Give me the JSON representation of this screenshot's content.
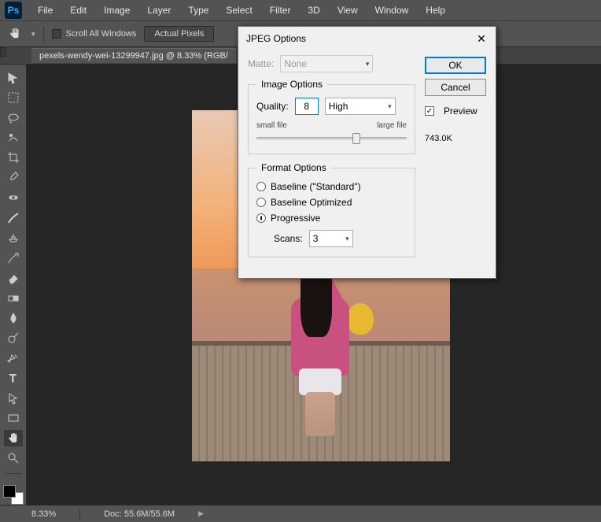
{
  "menubar": [
    "File",
    "Edit",
    "Image",
    "Layer",
    "Type",
    "Select",
    "Filter",
    "3D",
    "View",
    "Window",
    "Help"
  ],
  "optbar": {
    "scroll_all": "Scroll All Windows",
    "actual_pixels": "Actual Pixels"
  },
  "doc_tab": "pexels-wendy-wei-13299947.jpg @ 8.33% (RGB/",
  "status": {
    "zoom": "8.33%",
    "doc": "Doc: 55.6M/55.6M"
  },
  "dialog": {
    "title": "JPEG Options",
    "matte_label": "Matte:",
    "matte_value": "None",
    "image_options_legend": "Image Options",
    "quality_label": "Quality:",
    "quality_value": "8",
    "quality_preset": "High",
    "small_file": "small file",
    "large_file": "large file",
    "format_options_legend": "Format Options",
    "baseline_std": "Baseline (\"Standard\")",
    "baseline_opt": "Baseline Optimized",
    "progressive": "Progressive",
    "scans_label": "Scans:",
    "scans_value": "3",
    "ok": "OK",
    "cancel": "Cancel",
    "preview": "Preview",
    "filesize": "743.0K"
  }
}
